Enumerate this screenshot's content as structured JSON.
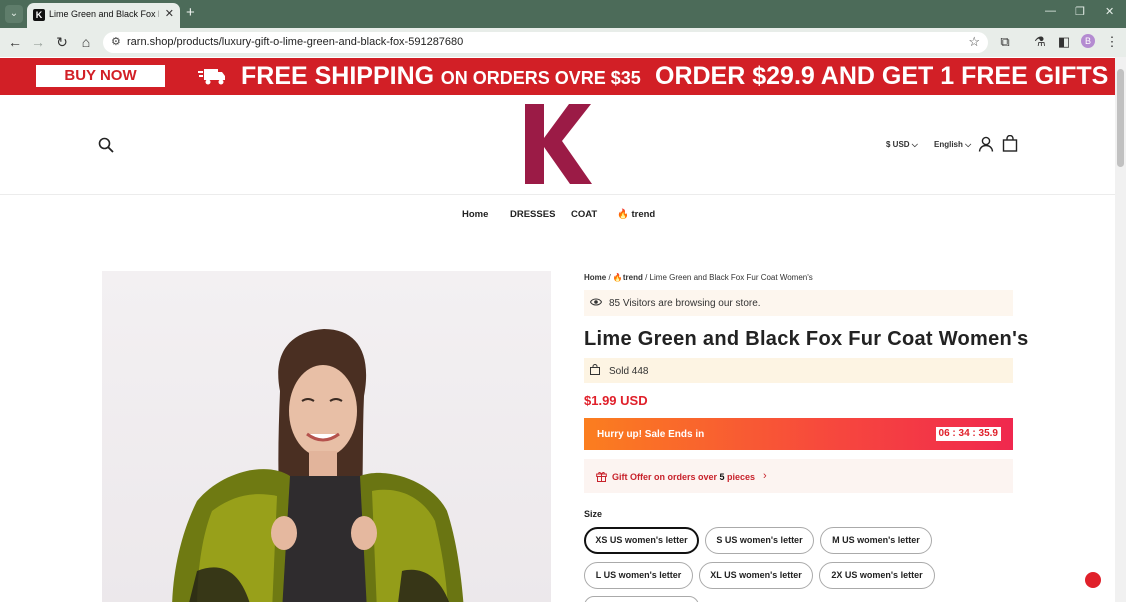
{
  "browser": {
    "tab_title": "Lime Green and Black Fox Fur",
    "tab_favicon_letter": "K",
    "url": "rarn.shop/products/luxury-gift-o-lime-green-and-black-fox-591287680",
    "profile_letter": "B"
  },
  "promo": {
    "buy_now": "BUY NOW",
    "free_shipping_big": "FREE SHIPPING",
    "free_shipping_small": "ON ORDERS OVRE $35",
    "order_gift": "ORDER $29.9 AND GET 1 FREE GIFTS",
    "background_color": "#d21f26"
  },
  "header": {
    "logo_letter": "K",
    "logo_color": "#9b1b46",
    "currency": "$ USD",
    "language": "English"
  },
  "nav": {
    "items": [
      "Home",
      "DRESSES",
      "COAT",
      "trend"
    ]
  },
  "breadcrumb": {
    "home": "Home",
    "trend": "trend",
    "current": "Lime Green and Black Fox Fur Coat Women's"
  },
  "product": {
    "visitors": "85 Visitors are browsing our store.",
    "title": "Lime Green and Black Fox Fur Coat Women's",
    "sold": "Sold 448",
    "price": "$1.99 USD",
    "sale_text": "Hurry up! Sale Ends in",
    "countdown": "06 : 34 : 35.9",
    "gift_offer_prefix": "Gift Offer on orders over ",
    "gift_offer_count": "5",
    "gift_offer_suffix": " pieces"
  },
  "size": {
    "label": "Size",
    "options": [
      "XS US women's letter",
      "S US women's letter",
      "M US women's letter",
      "L US women's letter",
      "XL US women's letter",
      "2X US women's letter"
    ],
    "selected": "XS US women's letter"
  }
}
